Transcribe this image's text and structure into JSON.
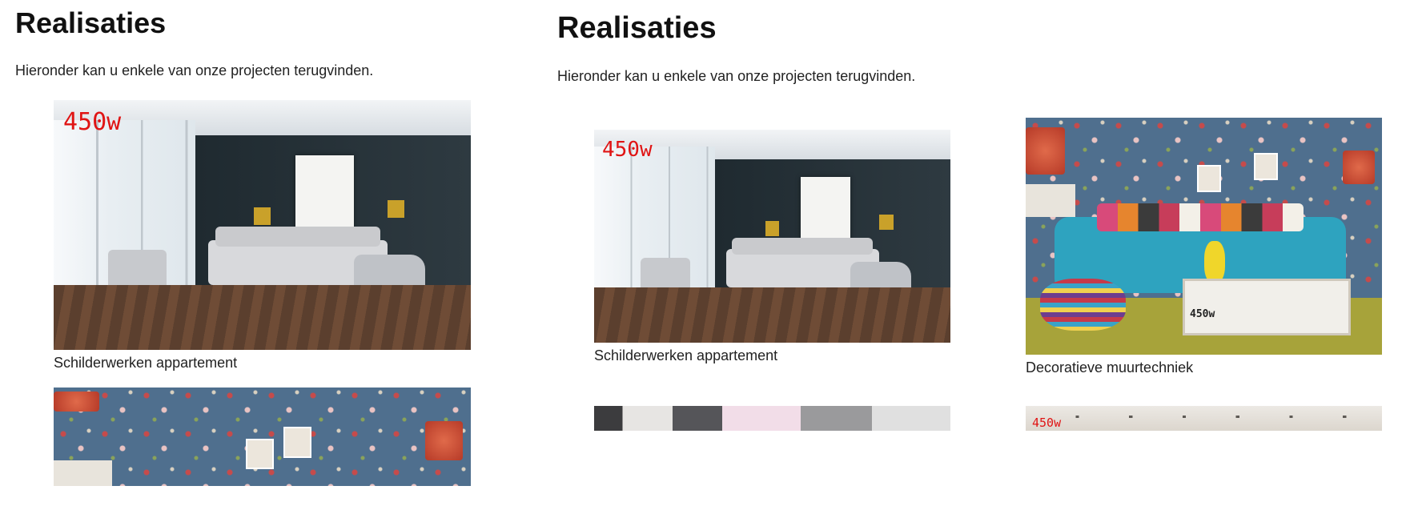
{
  "left": {
    "title": "Realisaties",
    "intro": "Hieronder kan u enkele van onze projecten terugvinden.",
    "projects": [
      {
        "caption": "Schilderwerken appartement",
        "tag": "450w"
      },
      {
        "caption": "",
        "tag": ""
      }
    ]
  },
  "right": {
    "title": "Realisaties",
    "intro": "Hieronder kan u enkele van onze projecten terugvinden.",
    "projects": [
      {
        "caption": "Schilderwerken appartement",
        "tag": "450w"
      },
      {
        "caption": "Decoratieve muurtechniek",
        "tag": "450w"
      },
      {
        "caption": "",
        "tag": ""
      },
      {
        "caption": "",
        "tag": "450w"
      }
    ]
  },
  "colors": {
    "text": "#222222",
    "watermark": "#e01414"
  }
}
